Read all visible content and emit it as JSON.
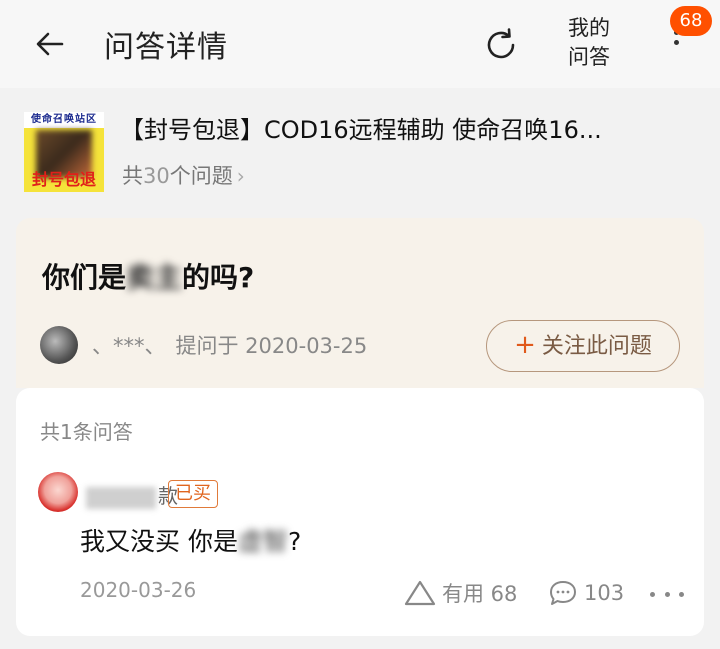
{
  "header": {
    "title": "问答详情",
    "my_qa_line1": "我的",
    "my_qa_line2": "问答",
    "badge_count": "68",
    "back_icon": "arrow-left-icon",
    "refresh_icon": "refresh-icon",
    "more_icon": "vertical-dots-icon"
  },
  "product": {
    "thumb_text_top": "使命召唤站区",
    "thumb_text_bottom": "封号包退",
    "title": "【封号包退】COD16远程辅助 使命召唤16...",
    "count_prefix": "共",
    "count_num": "30",
    "count_suffix": "个问题",
    "chevron": "›"
  },
  "question": {
    "text_start": "你们是",
    "text_blurred": "卖主",
    "text_end": "的吗?",
    "asker_name": "、***、",
    "asked_label": "提问于 2020-03-25",
    "follow_plus": "+",
    "follow_label": "关注此问题"
  },
  "answers": {
    "count_label": "共1条问答",
    "items": [
      {
        "name_visible": "款",
        "tag": "已买",
        "text_start": "我又没买 你是",
        "text_blurred": "虚智",
        "text_end": "?",
        "date": "2020-03-26",
        "useful_label": "有用 68",
        "comment_count": "103"
      }
    ]
  },
  "colors": {
    "accent": "#ff5000",
    "tag": "#e0651f",
    "question_bg": "#f7f2ea",
    "page_bg": "#f2f2f2"
  }
}
